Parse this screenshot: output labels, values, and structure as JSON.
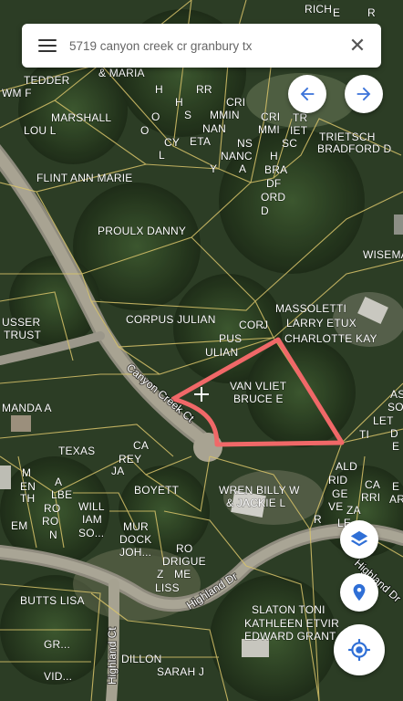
{
  "search": {
    "query": "5719 canyon creek cr granbury tx"
  },
  "colors": {
    "highlight_outline": "#f06868",
    "parcel_lines": "#d9c46a",
    "nav_button_icon": "#3b73d9",
    "map_control_icon": "#2f6fd6"
  },
  "icons": {
    "menu": "menu-icon",
    "close": "close-icon",
    "back": "arrow-left-icon",
    "forward": "arrow-right-icon",
    "layers": "layers-icon",
    "pin": "location-pin-icon",
    "locate": "my-location-icon",
    "crosshair": "crosshair-icon"
  },
  "streets": {
    "canyon_creek": "Canyon Creek Ct",
    "highland_dr_1": "Highland Dr",
    "highland_dr_2": "Highland Dr",
    "highland_ct": "Highland Ct"
  },
  "parcels": {
    "l01": "OD",
    "l02": "RICH",
    "l03": "E",
    "l04": "R",
    "l05": "& MARIA",
    "l06": "TEDDER",
    "l07": "WM F",
    "l08": "H",
    "l09": "RR",
    "l10": "MARSHALL",
    "l11": "O",
    "l12": "H",
    "l13": "CRI",
    "l14": "LOU L",
    "l15": "S",
    "l16": "MMIN",
    "l17": "CRI",
    "l18": "TR",
    "l19": "TRIETSCH",
    "l20": "BRADFORD D",
    "l21": "O",
    "l22": "CY",
    "l23": "NAN",
    "l24": "MMI",
    "l25": "IET",
    "l26": "L",
    "l27": "ETA",
    "l28": "NS",
    "l29": "SC",
    "l30": "NANC",
    "l31": "H",
    "l32": "Y",
    "l33": "A",
    "l34": "BRA",
    "l35": "FLINT ANN MARIE",
    "l36": "DF",
    "l37": "ORD",
    "l38": "D",
    "l39": "PROULX DANNY",
    "l40": "WISEMA",
    "l41": "MASSOLETTI",
    "l42": "LARRY ETUX",
    "l43": "CORPUS JULIAN",
    "l44": "CHARLOTTE KAY",
    "l45": "COR",
    "l46": "J",
    "l47": "USSER",
    "l48": "PUS",
    "l49": "TRUST",
    "l50": "ULIAN",
    "l51": "VAN VLIET",
    "l52": "BRUCE E",
    "l53": "MANDA A",
    "l54": "AS",
    "l55": "SO",
    "l56": "LET",
    "l57": "TI",
    "l58": "TEXAS",
    "l59": "CA",
    "l60": "REY",
    "l61": "JA",
    "l62": "D",
    "l63": "E",
    "l64": "ALD",
    "l65": "M",
    "l66": "RID",
    "l67": "EN",
    "l68": "GE",
    "l69": "TH",
    "l70": "A",
    "l71": "BOYETT",
    "l72": "WREN BILLY W",
    "l73": "& JACKIE L",
    "l74": "VE",
    "l75": "CA",
    "l76": "RRI",
    "l77": "R",
    "l78": "ZA",
    "l79": "AR",
    "l80": "E",
    "l81": "LBE",
    "l82": "WILL",
    "l83": "IAM",
    "l84": "SO...",
    "l85": "EM",
    "l86": "RO",
    "l87": "N",
    "l88": "LE",
    "l89": "RO",
    "l90": "MUR",
    "l91": "DOCK",
    "l92": "JOH...",
    "l93": "RO",
    "l94": "DRIGUE",
    "l95": "Z",
    "l96": "ME",
    "l97": "LISS",
    "l98": "BUTTS LISA",
    "l99": "SLATON TONI",
    "l100": "KATHLEEN ETVIR",
    "l101": "EDWARD GRANT",
    "l102": "GR...",
    "l103": "DILLON",
    "l104": "VID...",
    "l105": "SARAH J"
  }
}
